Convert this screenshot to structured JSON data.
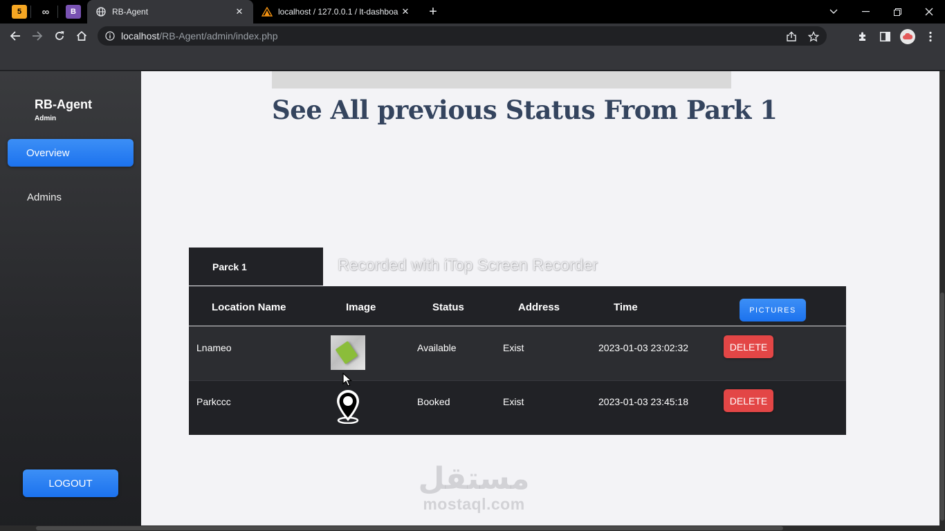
{
  "browser": {
    "pinned_tabs": [
      {
        "label": "5",
        "bg": "#f5a623",
        "fg": "#000000"
      },
      {
        "label": "∞",
        "bg": "#000000",
        "fg": "#cfcfcf"
      },
      {
        "label": "B",
        "bg": "#7952b3",
        "fg": "#ffffff"
      }
    ],
    "tabs": [
      {
        "title": "RB-Agent",
        "active": true
      },
      {
        "title": "localhost / 127.0.0.1 / lt-dashboa",
        "active": false
      }
    ],
    "url_host": "localhost",
    "url_path": "/RB-Agent/admin/index.php"
  },
  "sidebar": {
    "brand": "RB-Agent",
    "brand_sub": "Admin",
    "items": [
      {
        "label": "Overview",
        "active": true
      },
      {
        "label": "Admins",
        "active": false
      }
    ],
    "logout_label": "LOGOUT"
  },
  "main": {
    "page_title": "See All previous Status From Park 1",
    "park_tab": "Parck 1",
    "watermark": "Recorded with iTop Screen Recorder",
    "table": {
      "headers": [
        "Location Name",
        "Image",
        "Status",
        "Address",
        "Time"
      ],
      "pictures_label": "PICTURES",
      "rows": [
        {
          "location": "Lnameo",
          "image": "green-note-image",
          "status": "Available",
          "address": "Exist",
          "time": "2023-01-03 23:02:32",
          "action": "DELETE"
        },
        {
          "location": "Parkccc",
          "image": "map-pin-icon",
          "status": "Booked",
          "address": "Exist",
          "time": "2023-01-03 23:45:18",
          "action": "DELETE"
        }
      ]
    },
    "footer_logo_ar": "مستقل",
    "footer_logo_en": "mostaql.com"
  },
  "colors": {
    "accent": "#1c72ee",
    "danger": "#e34646",
    "sidebar_bg": "#28292c",
    "table_bg": "#212226",
    "title": "#34445e"
  }
}
